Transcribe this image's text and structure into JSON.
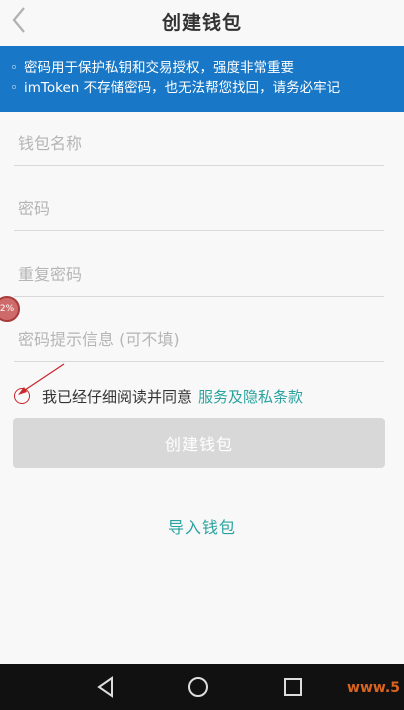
{
  "header": {
    "title": "创建钱包",
    "back_icon": "chevron-left-icon"
  },
  "notice": {
    "background": "#1877c6",
    "lines": [
      {
        "bullet": "◦",
        "text": "密码用于保护私钥和交易授权，强度非常重要"
      },
      {
        "bullet": "◦",
        "text": "imToken 不存储密码，也无法帮您找回，请务必牢记"
      }
    ]
  },
  "form": {
    "wallet_name": {
      "placeholder": "钱包名称",
      "value": ""
    },
    "password": {
      "placeholder": "密码",
      "value": ""
    },
    "repeat_password": {
      "placeholder": "重复密码",
      "value": ""
    },
    "password_hint": {
      "placeholder": "密码提示信息 (可不填)",
      "value": ""
    }
  },
  "agreement": {
    "checked": false,
    "text": "我已经仔细阅读并同意",
    "link_text": "服务及隐私条款"
  },
  "buttons": {
    "create_label": "创建钱包",
    "import_label": "导入钱包"
  },
  "annotation": {
    "badge_text": "2%"
  },
  "system_nav": {
    "icons": [
      "back-triangle-icon",
      "home-circle-icon",
      "recents-square-icon"
    ]
  },
  "watermark": {
    "text": "www.5"
  },
  "colors": {
    "accent": "#2aa3a0",
    "disabled_button": "#d8d8d8",
    "checkbox_border": "#c9252b"
  }
}
